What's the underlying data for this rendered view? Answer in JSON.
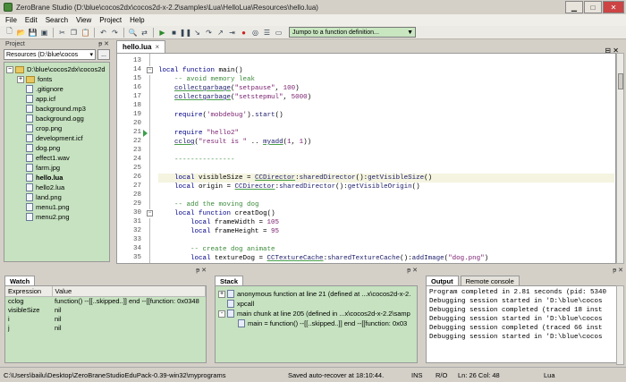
{
  "window": {
    "title": "ZeroBrane Studio (D:\\blue\\cocos2dx\\cocos2d-x-2.2\\samples\\Lua\\HelloLua\\Resources\\hello.lua)"
  },
  "menu": [
    "File",
    "Edit",
    "Search",
    "View",
    "Project",
    "Help"
  ],
  "toolbar": {
    "function_selector": "Jumpo to a function definition..."
  },
  "project": {
    "header": "Project",
    "root_combo": "Resources (D:\\blue\\cocos",
    "browse_button": "...",
    "root": "D:\\blue\\cocos2dx\\cocos2d",
    "items": [
      {
        "name": "fonts",
        "type": "folder"
      },
      {
        "name": ".gitignore",
        "type": "file"
      },
      {
        "name": "app.icf",
        "type": "file"
      },
      {
        "name": "background.mp3",
        "type": "file"
      },
      {
        "name": "background.ogg",
        "type": "file"
      },
      {
        "name": "crop.png",
        "type": "file"
      },
      {
        "name": "development.icf",
        "type": "file"
      },
      {
        "name": "dog.png",
        "type": "file"
      },
      {
        "name": "effect1.wav",
        "type": "file"
      },
      {
        "name": "farm.jpg",
        "type": "file"
      },
      {
        "name": "hello.lua",
        "type": "file",
        "active": true
      },
      {
        "name": "hello2.lua",
        "type": "file"
      },
      {
        "name": "land.png",
        "type": "file"
      },
      {
        "name": "menu1.png",
        "type": "file"
      },
      {
        "name": "menu2.png",
        "type": "file"
      }
    ]
  },
  "editor": {
    "tab": "hello.lua",
    "tab_close": "×",
    "breakpoint_line": 21,
    "current_line": 26,
    "lines": [
      {
        "n": "13",
        "text": ""
      },
      {
        "n": "14",
        "text": "local function main()"
      },
      {
        "n": "15",
        "text": "    -- avoid memory leak"
      },
      {
        "n": "16",
        "text": "    collectgarbage(\"setpause\", 100)"
      },
      {
        "n": "17",
        "text": "    collectgarbage(\"setstepmul\", 5000)"
      },
      {
        "n": "18",
        "text": ""
      },
      {
        "n": "19",
        "text": "    require('mobdebug').start()"
      },
      {
        "n": "20",
        "text": ""
      },
      {
        "n": "21",
        "text": "    require \"hello2\""
      },
      {
        "n": "22",
        "text": "    cclog(\"result is \" .. myadd(1, 1))"
      },
      {
        "n": "23",
        "text": ""
      },
      {
        "n": "24",
        "text": "    ---------------"
      },
      {
        "n": "25",
        "text": ""
      },
      {
        "n": "26",
        "text": "    local visibleSize = CCDirector:sharedDirector():getVisibleSize()"
      },
      {
        "n": "27",
        "text": "    local origin = CCDirector:sharedDirector():getVisibleOrigin()"
      },
      {
        "n": "28",
        "text": ""
      },
      {
        "n": "29",
        "text": "    -- add the moving dog"
      },
      {
        "n": "30",
        "text": "    local function creatDog()"
      },
      {
        "n": "31",
        "text": "        local frameWidth = 105"
      },
      {
        "n": "32",
        "text": "        local frameHeight = 95"
      },
      {
        "n": "33",
        "text": ""
      },
      {
        "n": "34",
        "text": "        -- create dog animate"
      },
      {
        "n": "35",
        "text": "        local textureDog = CCTextureCache:sharedTextureCache():addImage(\"dog.png\")"
      }
    ]
  },
  "watch": {
    "tab": "Watch",
    "columns": [
      "Expression",
      "Value"
    ],
    "rows": [
      {
        "expr": "cclog",
        "value": "function() --[[..skipped..]] end --[[function: 0x0348"
      },
      {
        "expr": "visibleSize",
        "value": "nil"
      },
      {
        "expr": "i",
        "value": "nil"
      },
      {
        "expr": "j",
        "value": "nil"
      }
    ]
  },
  "stack": {
    "tab": "Stack",
    "rows": [
      {
        "text": "anonymous function at line 21 (defined at ...x\\cocos2d-x-2.",
        "indent": 0,
        "exp": "+"
      },
      {
        "text": "xpcall",
        "indent": 0,
        "exp": ""
      },
      {
        "text": "main chunk at line 205 (defined in ...x\\cocos2d-x-2.2\\samp",
        "indent": 0,
        "exp": "-"
      },
      {
        "text": "main = function() --[[..skipped..]] end --[[function: 0x03",
        "indent": 1,
        "exp": ""
      }
    ]
  },
  "output": {
    "tabs": [
      "Output",
      "Remote console"
    ],
    "lines": [
      "Program completed in 2.81 seconds (pid: 5340",
      "Debugging session started in 'D:\\blue\\cocos",
      "Debugging session completed (traced 18 inst",
      "Debugging session started in 'D:\\blue\\cocos",
      "Debugging session completed (traced 66 inst",
      "Debugging session started in 'D:\\blue\\cocos"
    ]
  },
  "status": {
    "path": "C:\\Users\\bailu\\Desktop\\ZeroBraneStudioEduPack-0.39-win32\\myprograms",
    "message": "Saved auto-recover at 18:10:44.",
    "ins": "INS",
    "ro": "R/O",
    "position": "Ln: 26 Col: 48",
    "language": "Lua"
  }
}
